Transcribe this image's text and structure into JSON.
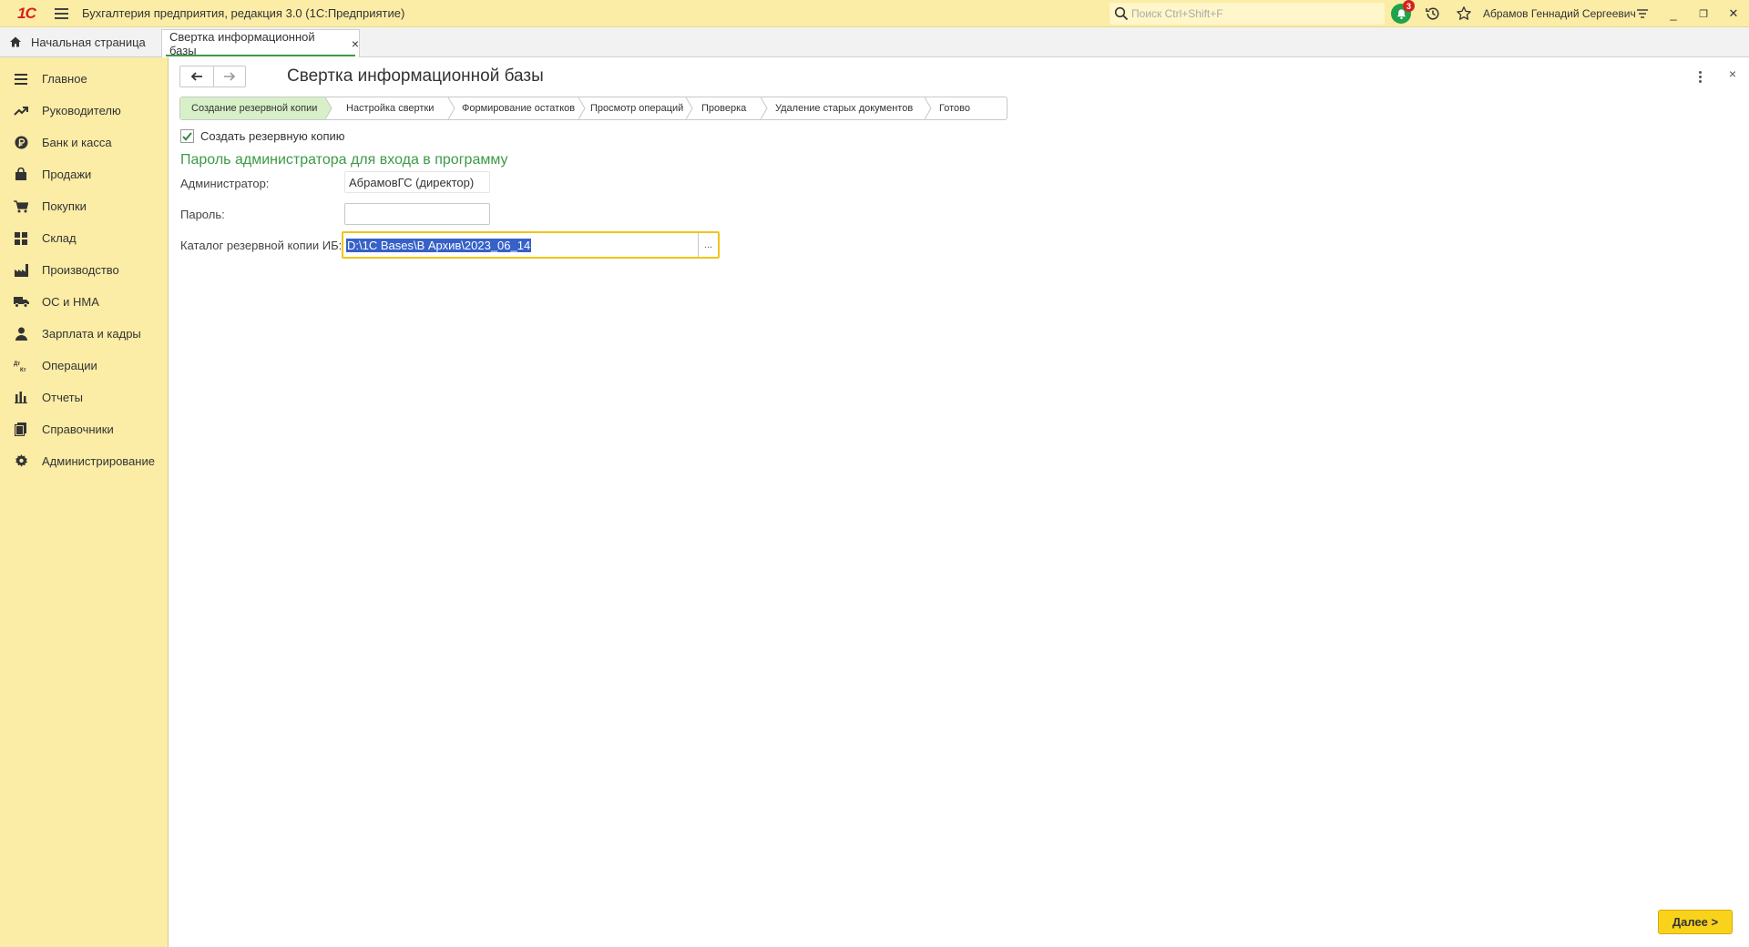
{
  "titlebar": {
    "logo": "1С",
    "app_title": "Бухгалтерия предприятия, редакция 3.0  (1С:Предприятие)",
    "search_placeholder": "Поиск Ctrl+Shift+F",
    "notifications_count": "3",
    "user_name": "Абрамов Геннадий Сергеевич",
    "win_minimize": "_",
    "win_restore": "❐",
    "win_close": "✕"
  },
  "tabs": {
    "home_label": "Начальная страница",
    "active_label": "Свертка информационной базы",
    "close_glyph": "×"
  },
  "sidebar": {
    "items": [
      {
        "label": "Главное",
        "icon": "list-icon"
      },
      {
        "label": "Руководителю",
        "icon": "trend-icon"
      },
      {
        "label": "Банк и касса",
        "icon": "ruble-icon"
      },
      {
        "label": "Продажи",
        "icon": "bag-icon"
      },
      {
        "label": "Покупки",
        "icon": "cart-icon"
      },
      {
        "label": "Склад",
        "icon": "grid-icon"
      },
      {
        "label": "Производство",
        "icon": "factory-icon"
      },
      {
        "label": "ОС и НМА",
        "icon": "truck-icon"
      },
      {
        "label": "Зарплата и кадры",
        "icon": "person-icon"
      },
      {
        "label": "Операции",
        "icon": "dt-kt-icon"
      },
      {
        "label": "Отчеты",
        "icon": "bar-chart-icon"
      },
      {
        "label": "Справочники",
        "icon": "books-icon"
      },
      {
        "label": "Администрирование",
        "icon": "gear-icon"
      }
    ]
  },
  "form": {
    "title": "Свертка информационной базы",
    "close_glyph": "×",
    "steps": [
      "Создание резервной копии",
      "Настройка свертки",
      "Формирование остатков",
      "Просмотр операций",
      "Проверка",
      "Удаление старых документов",
      "Готово"
    ],
    "create_backup_label": "Создать резервную копию",
    "create_backup_checked": true,
    "group_title": "Пароль администратора для входа в программу",
    "admin_label": "Администратор:",
    "admin_value": "АбрамовГС (директор)",
    "password_label": "Пароль:",
    "password_value": "",
    "backup_dir_label": "Каталог резервной копии ИБ:",
    "backup_dir_value": "D:\\1C Bases\\В Архив\\2023_06_14",
    "select_btn": "...",
    "next_button": "Далее >"
  },
  "colors": {
    "panel_yellow": "#fbeca6",
    "accent_green": "#3d9a47",
    "button_yellow": "#f9d21c",
    "focus_border": "#f0c419",
    "selection_blue": "#3561c9"
  }
}
